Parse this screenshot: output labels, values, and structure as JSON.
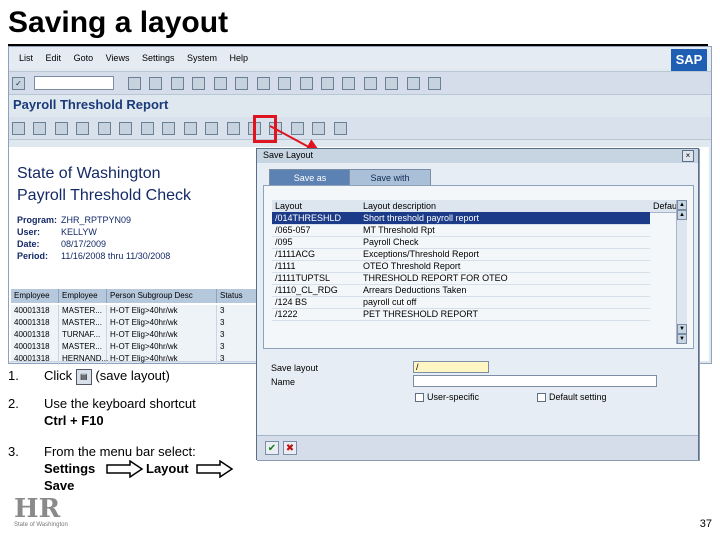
{
  "slide": {
    "title": "Saving a layout",
    "page_number": "37",
    "logo_text": "HR",
    "logo_caption": "State of Washington"
  },
  "sap": {
    "menu": [
      "List",
      "Edit",
      "Goto",
      "Views",
      "Settings",
      "System",
      "Help"
    ],
    "logo": "SAP",
    "report_title": "Payroll Threshold Report",
    "report_heading_1": "State of Washington",
    "report_heading_2": "Payroll Threshold Check",
    "meta": [
      {
        "label": "Program:",
        "value": "ZHR_RPTPYN09"
      },
      {
        "label": "User:",
        "value": "KELLYW"
      },
      {
        "label": "Date:",
        "value": "08/17/2009"
      },
      {
        "label": "Period:",
        "value": "11/16/2008 thru 11/30/2008"
      }
    ],
    "grid_headers": [
      "Employee",
      "Employee",
      "Person Subgroup Desc",
      "Status"
    ],
    "grid_rows": [
      [
        "40001318",
        "MASTER...",
        "H-OT Elig>40hr/wk",
        "3"
      ],
      [
        "40001318",
        "MASTER...",
        "H-OT Elig>40hr/wk",
        "3"
      ],
      [
        "40001318",
        "TURNAF...",
        "H-OT Elig>40hr/wk",
        "3"
      ],
      [
        "40001318",
        "MASTER...",
        "H-OT Elig>40hr/wk",
        "3"
      ],
      [
        "40001318",
        "HERNAND...",
        "H-OT Elig>40hr/wk",
        "3"
      ]
    ]
  },
  "dialog": {
    "title": "Save Layout",
    "tabs": [
      "Save as",
      "Save with"
    ],
    "columns": [
      "Layout",
      "Layout description",
      "Default"
    ],
    "rows": [
      {
        "layout": "/014THRESHLD",
        "desc": "Short threshold payroll report"
      },
      {
        "layout": "/065-057",
        "desc": "MT Threshold Rpt"
      },
      {
        "layout": "/095",
        "desc": "Payroll Check"
      },
      {
        "layout": "/1111ACG",
        "desc": "Exceptions/Threshold Report"
      },
      {
        "layout": "/1111",
        "desc": "OTEO Threshold Report"
      },
      {
        "layout": "/1111TUPTSL",
        "desc": "THRESHOLD REPORT FOR OTEO"
      },
      {
        "layout": "/1110_CL_RDG",
        "desc": "Arrears Deductions Taken"
      },
      {
        "layout": "/124 BS",
        "desc": "payroll cut off"
      },
      {
        "layout": "/1222",
        "desc": "PET THRESHOLD REPORT"
      }
    ],
    "save_layout_label": "Save layout",
    "save_layout_value": "/",
    "name_label": "Name",
    "user_specific_label": "User-specific",
    "default_setting_label": "Default setting"
  },
  "steps": [
    {
      "num": "1.",
      "text_before": "Click",
      "text_after": "(save layout)"
    },
    {
      "num": "2.",
      "line1": "Use the keyboard shortcut",
      "line2": "Ctrl + F10"
    },
    {
      "num": "3.",
      "line1": "From the menu bar select:",
      "word1": "Settings",
      "word2": "Layout",
      "word3": "Save"
    }
  ]
}
